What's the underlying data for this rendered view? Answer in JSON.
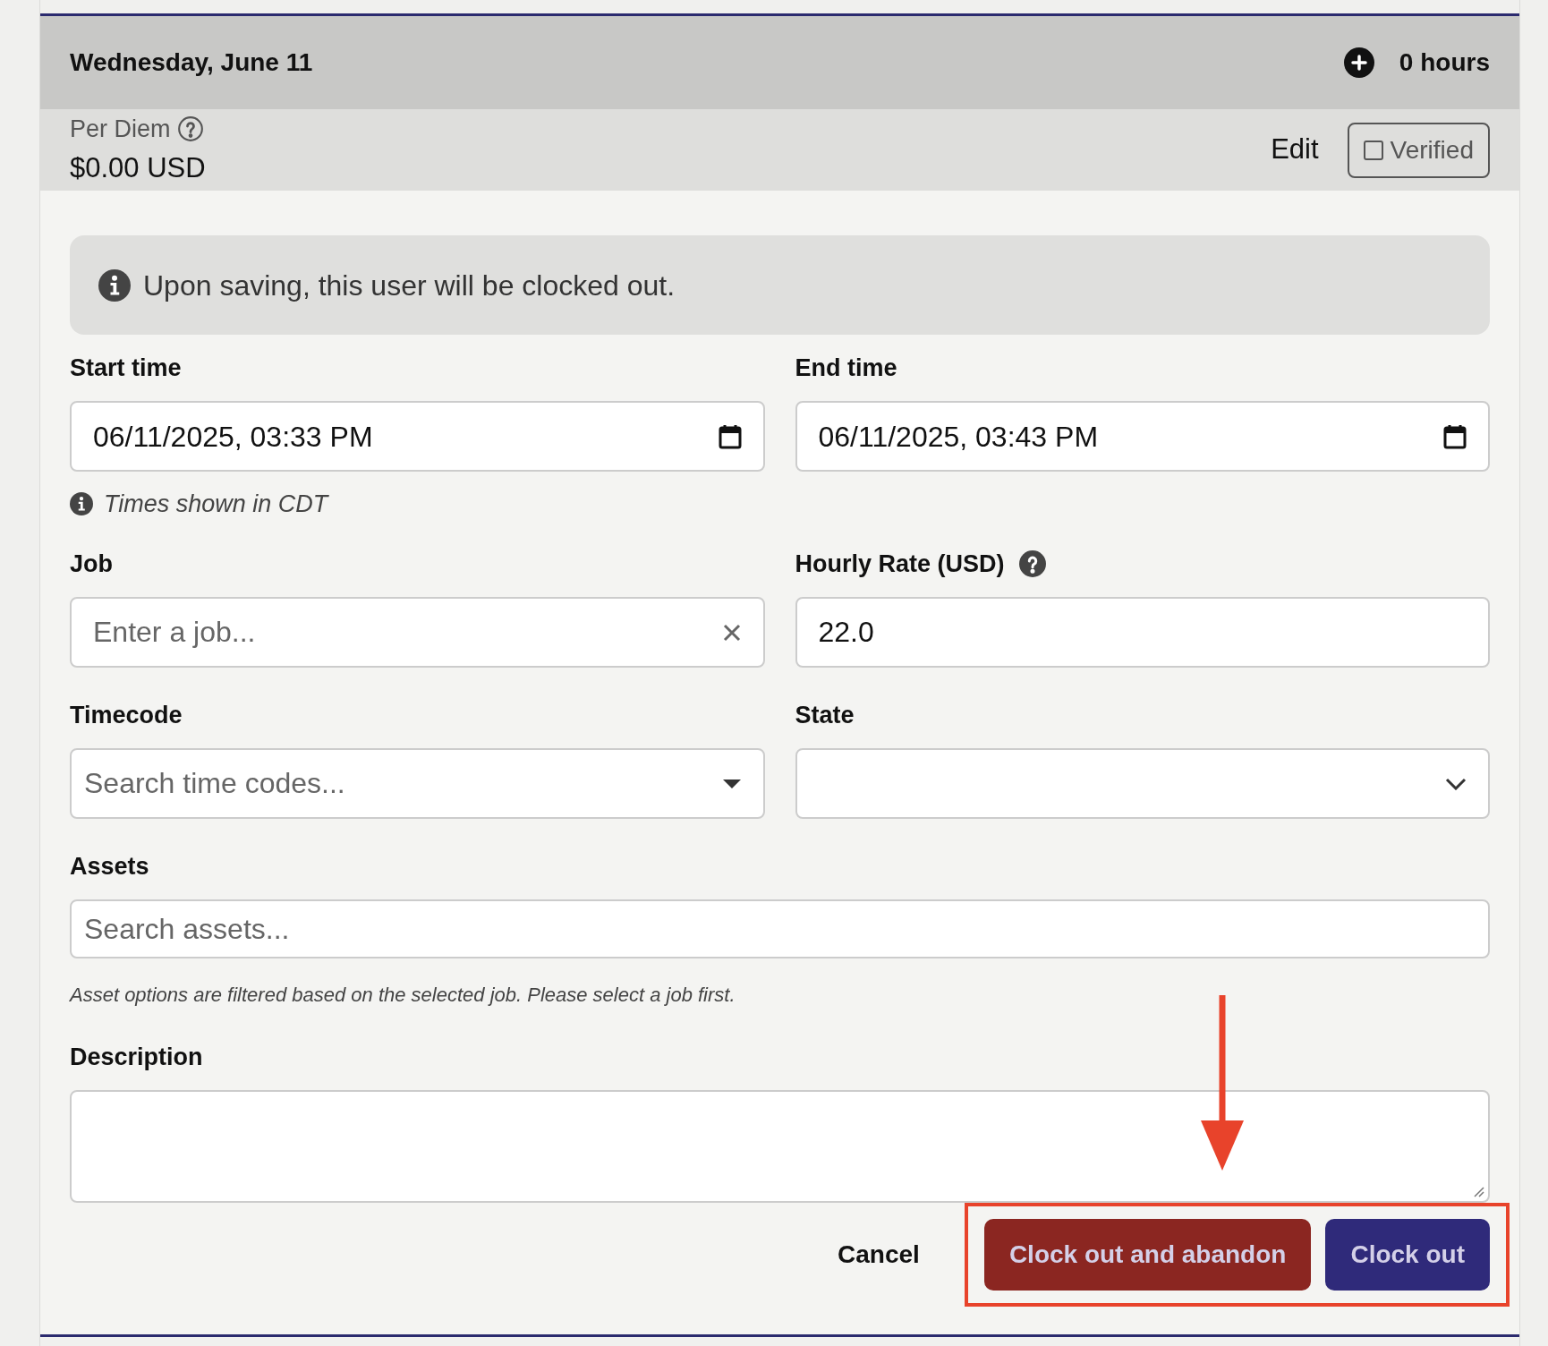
{
  "day_header": {
    "title": "Wednesday, June 11",
    "hours": "0 hours"
  },
  "per_diem": {
    "label": "Per Diem",
    "amount": "$0.00 USD",
    "edit": "Edit",
    "verified": {
      "label": "Verified",
      "checked": false
    }
  },
  "alert": {
    "text": "Upon saving, this user will be clocked out."
  },
  "fields": [
    {
      "kind": "datetime",
      "label": "Start time",
      "value": "06/11/2025, 03:33 PM",
      "hint": "Times shown in CDT"
    },
    {
      "kind": "datetime",
      "label": "End time",
      "value": "06/11/2025, 03:43 PM"
    },
    {
      "kind": "clearable",
      "label": "Job",
      "placeholder": "Enter a job..."
    },
    {
      "kind": "text",
      "label": "Hourly Rate (USD)",
      "value": "22.0",
      "help_icon": true
    },
    {
      "kind": "combo",
      "label": "Timecode",
      "placeholder": "Search time codes..."
    },
    {
      "kind": "select",
      "label": "State"
    },
    {
      "kind": "search",
      "label": "Assets",
      "placeholder": "Search assets...",
      "note": "Asset options are filtered based on the selected job. Please select a job first."
    },
    {
      "kind": "textarea",
      "label": "Description"
    }
  ],
  "actions": [
    {
      "kind": "link",
      "label": "Cancel"
    },
    {
      "kind": "danger",
      "label": "Clock out and abandon"
    },
    {
      "kind": "primary",
      "label": "Clock out"
    }
  ]
}
